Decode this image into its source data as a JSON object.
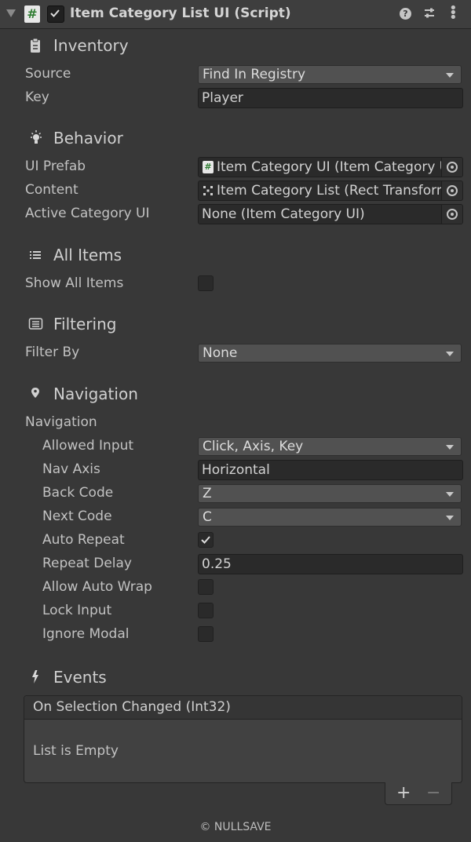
{
  "header": {
    "title": "Item Category List UI (Script)",
    "enabled": true,
    "script_icon_glyph": "#",
    "icons": [
      "foldout-arrow-icon",
      "script-icon",
      "help-icon",
      "preset-icon",
      "more-icon"
    ]
  },
  "inventory": {
    "title": "Inventory",
    "icon": "clipboard-icon",
    "source_label": "Source",
    "source_value": "Find In Registry",
    "key_label": "Key",
    "key_value": "Player"
  },
  "behavior": {
    "title": "Behavior",
    "icon": "lightbulb-icon",
    "ui_prefab_label": "UI Prefab",
    "ui_prefab_value": "Item Category UI (Item Category UI)",
    "content_label": "Content",
    "content_value": "Item Category List (Rect Transform)",
    "active_category_label": "Active Category UI",
    "active_category_value": "None (Item Category UI)"
  },
  "all_items": {
    "title": "All Items",
    "icon": "list-icon",
    "show_all_label": "Show All Items",
    "show_all_value": false
  },
  "filtering": {
    "title": "Filtering",
    "icon": "filter-list-icon",
    "filter_by_label": "Filter By",
    "filter_by_value": "None"
  },
  "navigation": {
    "title": "Navigation",
    "icon": "location-pin-icon",
    "group_label": "Navigation",
    "allowed_input_label": "Allowed Input",
    "allowed_input_value": "Click, Axis, Key",
    "nav_axis_label": "Nav Axis",
    "nav_axis_value": "Horizontal",
    "back_code_label": "Back Code",
    "back_code_value": "Z",
    "next_code_label": "Next Code",
    "next_code_value": "C",
    "auto_repeat_label": "Auto Repeat",
    "auto_repeat_value": true,
    "repeat_delay_label": "Repeat Delay",
    "repeat_delay_value": "0.25",
    "allow_auto_wrap_label": "Allow Auto Wrap",
    "allow_auto_wrap_value": false,
    "lock_input_label": "Lock Input",
    "lock_input_value": false,
    "ignore_modal_label": "Ignore Modal",
    "ignore_modal_value": false
  },
  "events": {
    "title": "Events",
    "icon": "lightning-icon",
    "event_name": "On Selection Changed (Int32)",
    "empty_text": "List is Empty",
    "add_glyph": "+",
    "remove_glyph": "−"
  },
  "footer": {
    "text": "© NULLSAVE"
  },
  "colors": {
    "background": "#383838",
    "header": "#3e3e3e",
    "field": "#2a2a2a",
    "dropdown": "#515151",
    "text": "#c8c8c8"
  }
}
